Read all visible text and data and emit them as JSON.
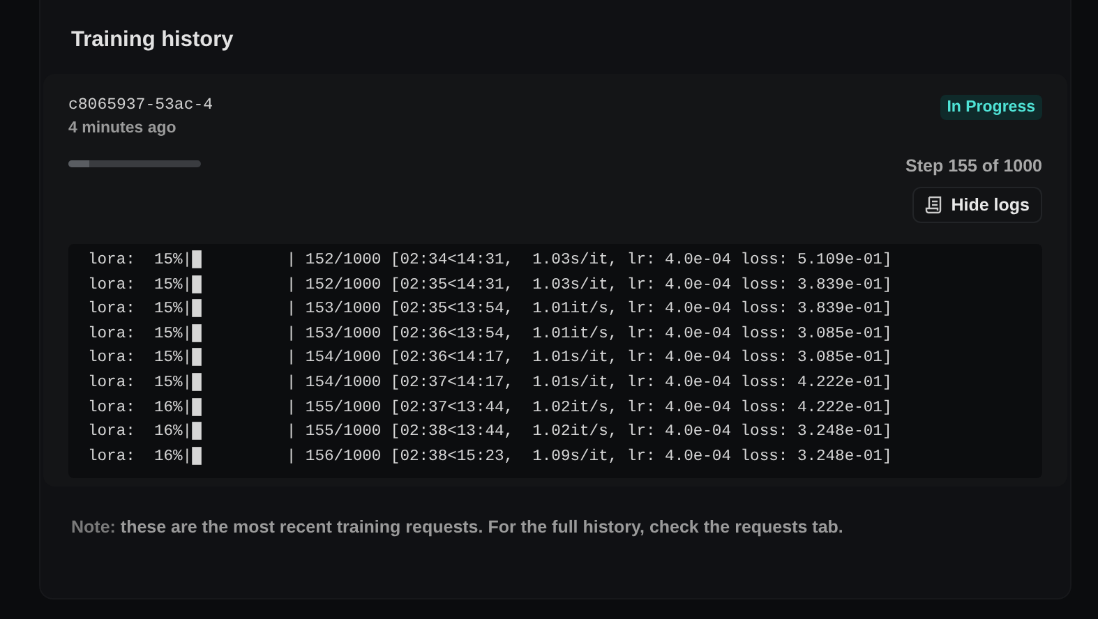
{
  "title": "Training history",
  "job": {
    "id": "c8065937-53ac-4",
    "time": "4 minutes ago",
    "status": "In Progress",
    "level": 0.155,
    "step": "Step 155 of 1000",
    "logs_button": "Hide logs"
  },
  "logs": [
    "lora:  15%|█         | 152/1000 [02:34<14:31,  1.03s/it, lr: 4.0e-04 loss: 5.109e-01]",
    "lora:  15%|█         | 152/1000 [02:35<14:31,  1.03s/it, lr: 4.0e-04 loss: 3.839e-01]",
    "lora:  15%|█         | 153/1000 [02:35<13:54,  1.01it/s, lr: 4.0e-04 loss: 3.839e-01]",
    "lora:  15%|█         | 153/1000 [02:36<13:54,  1.01it/s, lr: 4.0e-04 loss: 3.085e-01]",
    "lora:  15%|█         | 154/1000 [02:36<14:17,  1.01s/it, lr: 4.0e-04 loss: 3.085e-01]",
    "lora:  15%|█         | 154/1000 [02:37<14:17,  1.01s/it, lr: 4.0e-04 loss: 4.222e-01]",
    "lora:  16%|█         | 155/1000 [02:37<13:44,  1.02it/s, lr: 4.0e-04 loss: 4.222e-01]",
    "lora:  16%|█         | 155/1000 [02:38<13:44,  1.02it/s, lr: 4.0e-04 loss: 3.248e-01]",
    "lora:  16%|█         | 156/1000 [02:38<15:23,  1.09s/it, lr: 4.0e-04 loss: 3.248e-01]"
  ],
  "note": "**Note:** these are the most recent training requests. For the full history, check the requests tab."
}
